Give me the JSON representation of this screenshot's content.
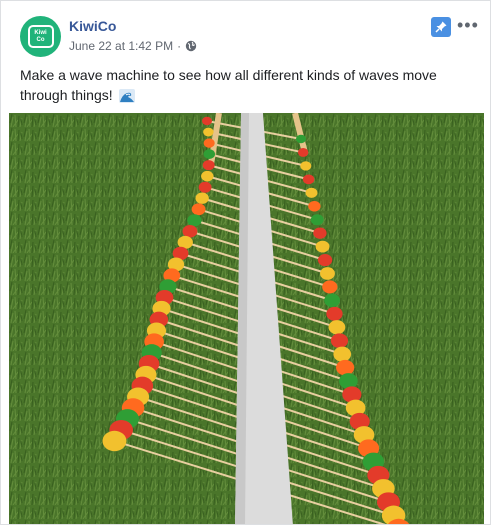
{
  "post": {
    "page_name": "KiwiCo",
    "avatar_line1": "Kiwi",
    "avatar_line2": "Co",
    "date": "June 22 at 1:42 PM",
    "separator": "·",
    "text": "Make a wave machine to see how all different kinds of waves move through things!",
    "more_label": "•••"
  },
  "icons": {
    "avatar": "kiwico-logo-icon",
    "globe": "globe-icon",
    "pin": "pin-icon",
    "more": "more-options-icon",
    "wave": "water-wave-emoji-icon"
  },
  "colors": {
    "page_name": "#385898",
    "avatar_bg": "#20b37a",
    "pin_bg": "#4a90e2",
    "grass": "#4c7a2c"
  }
}
